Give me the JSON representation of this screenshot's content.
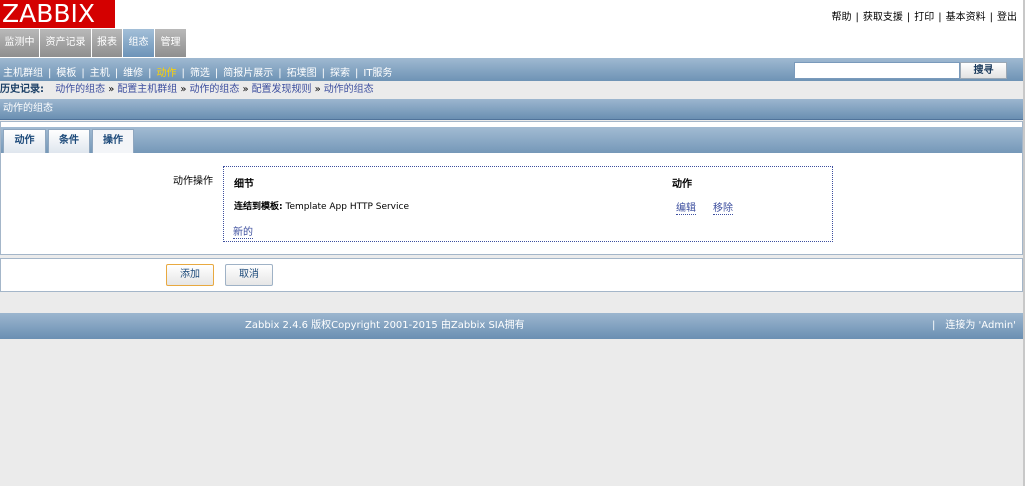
{
  "header": {
    "logo": "ZABBIX",
    "links": [
      "帮助",
      "获取支援",
      "打印",
      "基本资料",
      "登出"
    ]
  },
  "main_menu": [
    {
      "label": "监测中",
      "active": false
    },
    {
      "label": "资产记录",
      "active": false
    },
    {
      "label": "报表",
      "active": false
    },
    {
      "label": "组态",
      "active": true
    },
    {
      "label": "管理",
      "active": false
    }
  ],
  "sub_menu": {
    "items": [
      "主机群组",
      "模板",
      "主机",
      "维修",
      "动作",
      "筛选",
      "简报片展示",
      "拓墣图",
      "探索",
      "IT服务"
    ],
    "current": "动作",
    "search_button": "搜寻",
    "search_value": ""
  },
  "history": {
    "label": "历史记录:",
    "items": [
      "动作的组态",
      "配置主机群组",
      "动作的组态",
      "配置发现规则",
      "动作的组态"
    ],
    "separator": "»"
  },
  "page_title": "动作的组态",
  "tabs": [
    {
      "label": "动作",
      "active": false
    },
    {
      "label": "条件",
      "active": false
    },
    {
      "label": "操作",
      "active": true
    }
  ],
  "operations": {
    "field_label": "动作操作",
    "col_detail": "细节",
    "col_action": "动作",
    "row_prefix": "连结到模板:",
    "row_value": " Template App HTTP Service",
    "edit_link": "编辑",
    "remove_link": "移除",
    "new_link": "新的"
  },
  "form_buttons": {
    "add": "添加",
    "cancel": "取消"
  },
  "footer": {
    "copyright": "Zabbix 2.4.6 版权Copyright 2001-2015 由Zabbix SIA拥有",
    "separator": "|",
    "connected": "连接为 'Admin'"
  },
  "colors": {
    "logo_red": "#d40000",
    "header_blue": "#7598b8",
    "current_menu": "#ffd200",
    "link": "#3d4f9f"
  }
}
